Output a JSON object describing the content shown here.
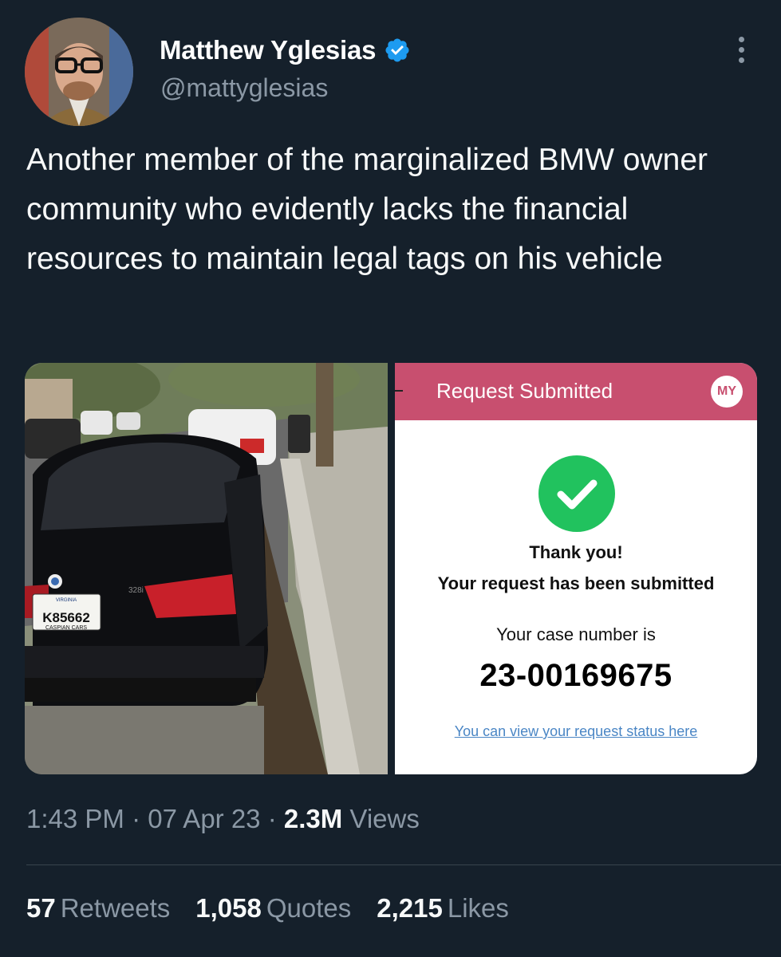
{
  "author": {
    "display_name": "Matthew Yglesias",
    "handle": "@mattyglesias",
    "verified_icon": "verified-badge-icon",
    "avatar": "avatar"
  },
  "tweet": {
    "text": "Another member of the marginalized BMW owner community who evidently lacks the financial resources to maintain legal tags on his vehicle"
  },
  "media": {
    "photo": {
      "plate_number": "K85662",
      "plate_state": "VIRGINIA",
      "plate_dealer": "CASPIAN CARS",
      "model_badge": "328i"
    },
    "screenshot": {
      "header_title": "Request Submitted",
      "badge": "MY",
      "thanks_line1": "Thank you!",
      "thanks_line2": "Your request has been submitted",
      "case_label": "Your case number is",
      "case_number": "23-00169675",
      "status_link": "You can view your request status here",
      "accent_color": "#c84f6f",
      "check_color": "#21c25e"
    }
  },
  "meta": {
    "time": "1:43 PM",
    "date": "07 Apr 23",
    "views_count": "2.3M",
    "views_label": "Views",
    "separator": "·"
  },
  "stats": {
    "retweets_count": "57",
    "retweets_label": "Retweets",
    "quotes_count": "1,058",
    "quotes_label": "Quotes",
    "likes_count": "2,215",
    "likes_label": "Likes"
  },
  "colors": {
    "background": "#15202b",
    "secondary_text": "#8b98a5",
    "verified_blue": "#1d9bf0"
  }
}
